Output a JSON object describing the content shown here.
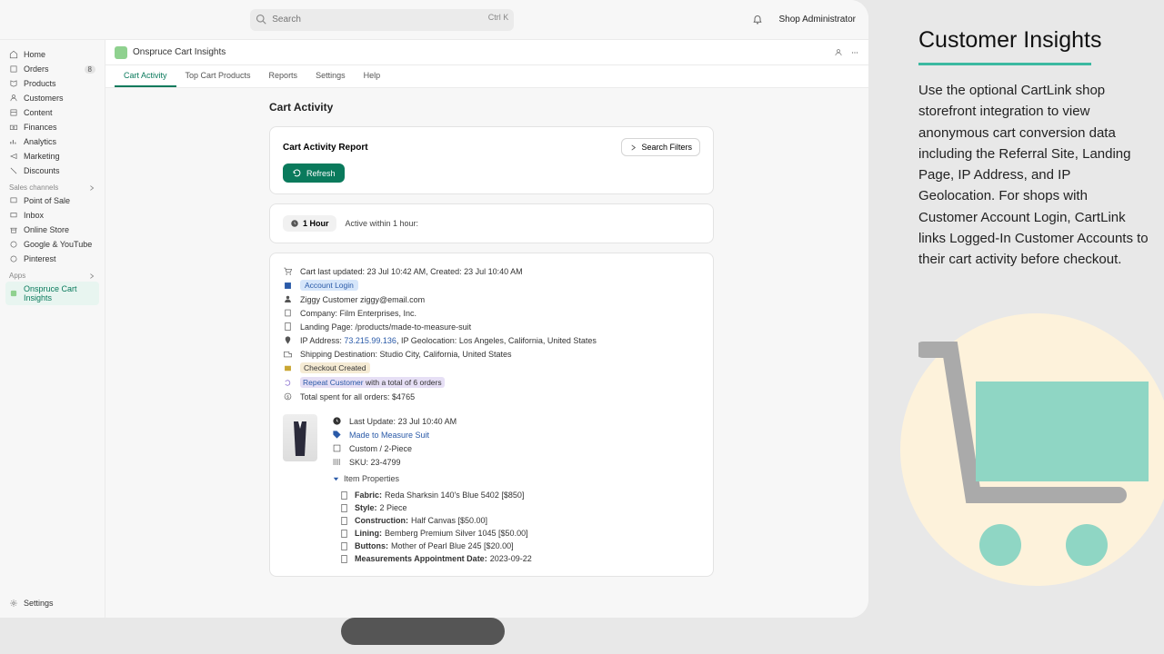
{
  "topbar": {
    "search_placeholder": "Search",
    "kbd": "Ctrl K",
    "shop_admin": "Shop Administrator"
  },
  "sidebar": {
    "nav": [
      {
        "label": "Home"
      },
      {
        "label": "Orders",
        "badge": "8"
      },
      {
        "label": "Products"
      },
      {
        "label": "Customers"
      },
      {
        "label": "Content"
      },
      {
        "label": "Finances"
      },
      {
        "label": "Analytics"
      },
      {
        "label": "Marketing"
      },
      {
        "label": "Discounts"
      }
    ],
    "sales_hdr": "Sales channels",
    "sales": [
      {
        "label": "Point of Sale"
      },
      {
        "label": "Inbox"
      },
      {
        "label": "Online Store"
      },
      {
        "label": "Google & YouTube"
      },
      {
        "label": "Pinterest"
      }
    ],
    "apps_hdr": "Apps",
    "apps": [
      {
        "label": "Onspruce Cart Insights"
      }
    ],
    "settings": "Settings"
  },
  "app": {
    "name": "Onspruce Cart Insights"
  },
  "tabs": [
    {
      "label": "Cart Activity",
      "active": true
    },
    {
      "label": "Top Cart Products"
    },
    {
      "label": "Reports"
    },
    {
      "label": "Settings"
    },
    {
      "label": "Help"
    }
  ],
  "page_title": "Cart Activity",
  "report": {
    "title": "Cart Activity Report",
    "filters": "Search Filters",
    "refresh": "Refresh"
  },
  "timeframe": {
    "pill": "1 Hour",
    "text": "Active within 1 hour:"
  },
  "cart": {
    "updated_created": "Cart last updated: 23 Jul 10:42 AM, Created: 23 Jul 10:40 AM",
    "account_login": "Account Login",
    "customer": "Ziggy Customer ziggy@email.com",
    "company": "Company: Film Enterprises, Inc.",
    "landing": "Landing Page: /products/made-to-measure-suit",
    "ip_prefix": "IP Address: ",
    "ip": "73.215.99.136",
    "ip_suffix": ", IP Geolocation: Los Angeles, California, United States",
    "shipping": "Shipping Destination: Studio City, California, United States",
    "checkout_created": "Checkout Created",
    "repeat_a": "Repeat Customer",
    "repeat_b": " with a total of 6 orders",
    "total_spent": "Total spent for all orders: $4765"
  },
  "product": {
    "last_update_label": "Last Update:",
    "last_update_val": "23 Jul 10:40 AM",
    "name": "Made to Measure Suit",
    "variant": "Custom / 2-Piece",
    "sku": "SKU: 23-4799",
    "props_hdr": "Item Properties",
    "props": [
      {
        "k": "Fabric:",
        "v": "Reda Sharksin 140's Blue 5402 [$850]"
      },
      {
        "k": "Style:",
        "v": "2 Piece"
      },
      {
        "k": "Construction:",
        "v": "Half Canvas [$50.00]"
      },
      {
        "k": "Lining:",
        "v": "Bemberg Premium Silver 1045 [$50.00]"
      },
      {
        "k": "Buttons:",
        "v": "Mother of Pearl Blue 245 [$20.00]"
      },
      {
        "k": "Measurements Appointment Date:",
        "v": "2023-09-22"
      }
    ]
  },
  "sidepanel": {
    "title": "Customer Insights",
    "body": "Use the optional CartLink shop storefront integration to view anonymous cart conversion data including the Referral Site, Landing Page, IP Address, and IP Geolocation.  For shops with Customer Account Login, CartLink links Logged-In Customer Accounts to their cart activity before checkout."
  }
}
